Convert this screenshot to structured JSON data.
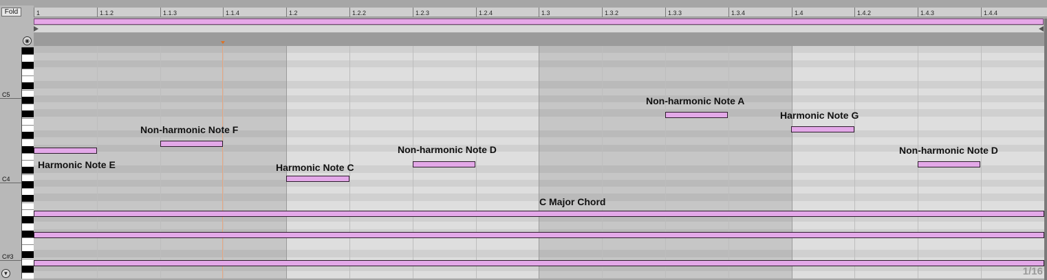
{
  "fold_label": "Fold",
  "ruler_labels": [
    "1",
    "1.1.2",
    "1.1.3",
    "1.1.4",
    "1.2",
    "1.2.2",
    "1.2.3",
    "1.2.4",
    "1.3",
    "1.3.2",
    "1.3.3",
    "1.3.4",
    "1.4",
    "1.4.2",
    "1.4.3",
    "1.4.4"
  ],
  "piano": {
    "labels": [
      "C5",
      "C4",
      "C#3"
    ]
  },
  "annotations": {
    "harmonic_e": "Harmonic Note E",
    "nonharmonic_f": "Non-harmonic Note F",
    "harmonic_c": "Harmonic Note C",
    "nonharmonic_d1": "Non-harmonic Note D",
    "nonharmonic_a": "Non-harmonic Note A",
    "harmonic_g": "Harmonic Note G",
    "nonharmonic_d2": "Non-harmonic Note D",
    "chord": "C Major Chord"
  },
  "grid_quantize": "1/16",
  "colors": {
    "note_fill": "#e3a8e8",
    "note_border": "#2b1a2b",
    "playhead": "#e07020"
  }
}
